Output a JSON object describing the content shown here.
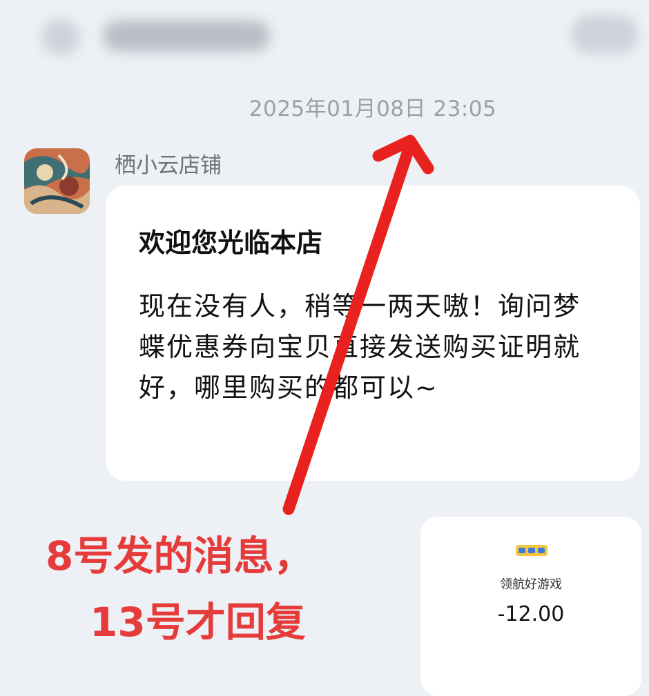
{
  "header": {
    "back_icon": "back-icon",
    "title_blurred": true,
    "more_icon": "more-icon"
  },
  "timestamp": "2025年01月08日 23:05",
  "message": {
    "shop_name": "栖小云店铺",
    "title": "欢迎您光临本店",
    "body": "现在没有人，稍等一两天嗷！询问梦蝶优惠券向宝贝直接发送购买证明就好，哪里购买的都可以~"
  },
  "card": {
    "name": "领航好游戏",
    "amount": "-12.00"
  },
  "annotation": {
    "line1": "8号发的消息，",
    "line2": "13号才回复",
    "color": "#e53b3b"
  }
}
